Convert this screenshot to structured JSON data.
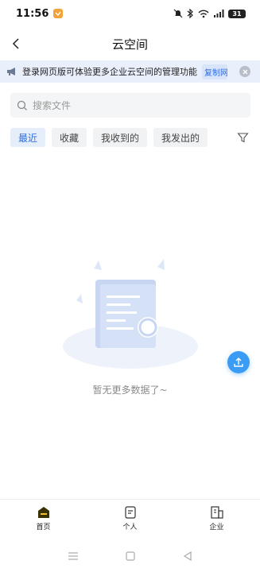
{
  "status_bar": {
    "time": "11:56",
    "battery": "31",
    "icons": [
      "app-notification-icon",
      "silent-bell-icon",
      "bluetooth-icon",
      "wifi-icon",
      "signal-5g-icon",
      "battery-icon"
    ]
  },
  "header": {
    "title": "云空间"
  },
  "banner": {
    "text": "登录网页版可体验更多企业云空间的管理功能",
    "copy_link": "复制网"
  },
  "search": {
    "placeholder": "搜索文件"
  },
  "filters": {
    "items": [
      {
        "label": "最近",
        "active": true
      },
      {
        "label": "收藏",
        "active": false
      },
      {
        "label": "我收到的",
        "active": false
      },
      {
        "label": "我发出的",
        "active": false
      }
    ]
  },
  "empty_state": {
    "text": "暂无更多数据了~"
  },
  "bottom_nav": {
    "items": [
      {
        "label": "首页",
        "icon": "home-icon",
        "active": true
      },
      {
        "label": "个人",
        "icon": "personal-doc-icon",
        "active": false
      },
      {
        "label": "企业",
        "icon": "enterprise-building-icon",
        "active": false
      }
    ]
  },
  "colors": {
    "accent": "#2f6fe0",
    "banner_bg": "#eaf0fb",
    "fab": "#3a9cf4",
    "home_active": "#3a3000"
  }
}
